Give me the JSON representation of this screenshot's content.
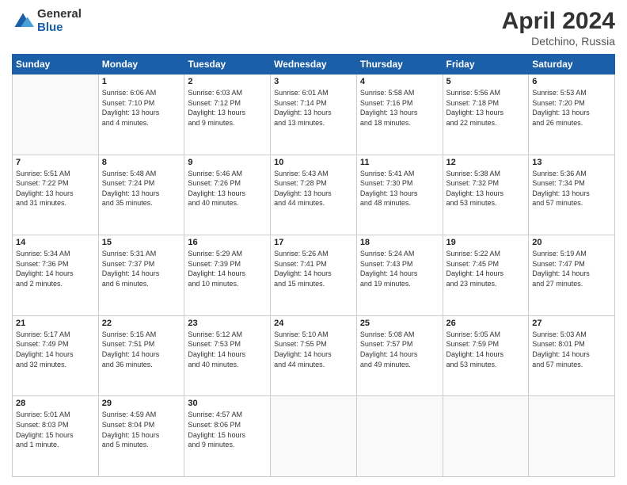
{
  "logo": {
    "general": "General",
    "blue": "Blue"
  },
  "title": "April 2024",
  "location": "Detchino, Russia",
  "days_of_week": [
    "Sunday",
    "Monday",
    "Tuesday",
    "Wednesday",
    "Thursday",
    "Friday",
    "Saturday"
  ],
  "weeks": [
    [
      {
        "day": "",
        "info": ""
      },
      {
        "day": "1",
        "info": "Sunrise: 6:06 AM\nSunset: 7:10 PM\nDaylight: 13 hours\nand 4 minutes."
      },
      {
        "day": "2",
        "info": "Sunrise: 6:03 AM\nSunset: 7:12 PM\nDaylight: 13 hours\nand 9 minutes."
      },
      {
        "day": "3",
        "info": "Sunrise: 6:01 AM\nSunset: 7:14 PM\nDaylight: 13 hours\nand 13 minutes."
      },
      {
        "day": "4",
        "info": "Sunrise: 5:58 AM\nSunset: 7:16 PM\nDaylight: 13 hours\nand 18 minutes."
      },
      {
        "day": "5",
        "info": "Sunrise: 5:56 AM\nSunset: 7:18 PM\nDaylight: 13 hours\nand 22 minutes."
      },
      {
        "day": "6",
        "info": "Sunrise: 5:53 AM\nSunset: 7:20 PM\nDaylight: 13 hours\nand 26 minutes."
      }
    ],
    [
      {
        "day": "7",
        "info": "Sunrise: 5:51 AM\nSunset: 7:22 PM\nDaylight: 13 hours\nand 31 minutes."
      },
      {
        "day": "8",
        "info": "Sunrise: 5:48 AM\nSunset: 7:24 PM\nDaylight: 13 hours\nand 35 minutes."
      },
      {
        "day": "9",
        "info": "Sunrise: 5:46 AM\nSunset: 7:26 PM\nDaylight: 13 hours\nand 40 minutes."
      },
      {
        "day": "10",
        "info": "Sunrise: 5:43 AM\nSunset: 7:28 PM\nDaylight: 13 hours\nand 44 minutes."
      },
      {
        "day": "11",
        "info": "Sunrise: 5:41 AM\nSunset: 7:30 PM\nDaylight: 13 hours\nand 48 minutes."
      },
      {
        "day": "12",
        "info": "Sunrise: 5:38 AM\nSunset: 7:32 PM\nDaylight: 13 hours\nand 53 minutes."
      },
      {
        "day": "13",
        "info": "Sunrise: 5:36 AM\nSunset: 7:34 PM\nDaylight: 13 hours\nand 57 minutes."
      }
    ],
    [
      {
        "day": "14",
        "info": "Sunrise: 5:34 AM\nSunset: 7:36 PM\nDaylight: 14 hours\nand 2 minutes."
      },
      {
        "day": "15",
        "info": "Sunrise: 5:31 AM\nSunset: 7:37 PM\nDaylight: 14 hours\nand 6 minutes."
      },
      {
        "day": "16",
        "info": "Sunrise: 5:29 AM\nSunset: 7:39 PM\nDaylight: 14 hours\nand 10 minutes."
      },
      {
        "day": "17",
        "info": "Sunrise: 5:26 AM\nSunset: 7:41 PM\nDaylight: 14 hours\nand 15 minutes."
      },
      {
        "day": "18",
        "info": "Sunrise: 5:24 AM\nSunset: 7:43 PM\nDaylight: 14 hours\nand 19 minutes."
      },
      {
        "day": "19",
        "info": "Sunrise: 5:22 AM\nSunset: 7:45 PM\nDaylight: 14 hours\nand 23 minutes."
      },
      {
        "day": "20",
        "info": "Sunrise: 5:19 AM\nSunset: 7:47 PM\nDaylight: 14 hours\nand 27 minutes."
      }
    ],
    [
      {
        "day": "21",
        "info": "Sunrise: 5:17 AM\nSunset: 7:49 PM\nDaylight: 14 hours\nand 32 minutes."
      },
      {
        "day": "22",
        "info": "Sunrise: 5:15 AM\nSunset: 7:51 PM\nDaylight: 14 hours\nand 36 minutes."
      },
      {
        "day": "23",
        "info": "Sunrise: 5:12 AM\nSunset: 7:53 PM\nDaylight: 14 hours\nand 40 minutes."
      },
      {
        "day": "24",
        "info": "Sunrise: 5:10 AM\nSunset: 7:55 PM\nDaylight: 14 hours\nand 44 minutes."
      },
      {
        "day": "25",
        "info": "Sunrise: 5:08 AM\nSunset: 7:57 PM\nDaylight: 14 hours\nand 49 minutes."
      },
      {
        "day": "26",
        "info": "Sunrise: 5:05 AM\nSunset: 7:59 PM\nDaylight: 14 hours\nand 53 minutes."
      },
      {
        "day": "27",
        "info": "Sunrise: 5:03 AM\nSunset: 8:01 PM\nDaylight: 14 hours\nand 57 minutes."
      }
    ],
    [
      {
        "day": "28",
        "info": "Sunrise: 5:01 AM\nSunset: 8:03 PM\nDaylight: 15 hours\nand 1 minute."
      },
      {
        "day": "29",
        "info": "Sunrise: 4:59 AM\nSunset: 8:04 PM\nDaylight: 15 hours\nand 5 minutes."
      },
      {
        "day": "30",
        "info": "Sunrise: 4:57 AM\nSunset: 8:06 PM\nDaylight: 15 hours\nand 9 minutes."
      },
      {
        "day": "",
        "info": ""
      },
      {
        "day": "",
        "info": ""
      },
      {
        "day": "",
        "info": ""
      },
      {
        "day": "",
        "info": ""
      }
    ]
  ]
}
